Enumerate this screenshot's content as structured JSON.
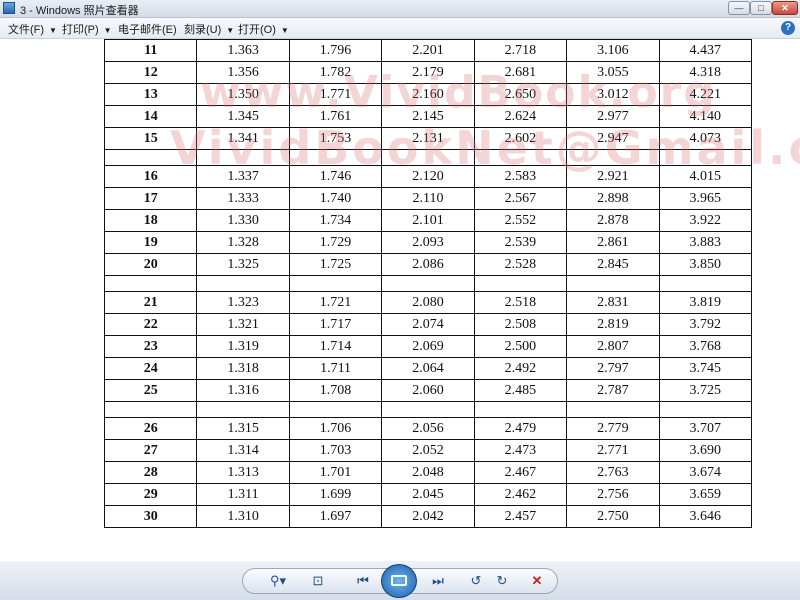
{
  "window": {
    "title": "3 - Windows 照片查看器",
    "controls": {
      "minimize": "—",
      "maximize": "□",
      "close": "✕"
    }
  },
  "menu": {
    "items": [
      {
        "label": "文件(F)"
      },
      {
        "label": "打印(P)"
      },
      {
        "label": "电子邮件(E)"
      },
      {
        "label": "刻录(U)"
      },
      {
        "label": "打开(O)"
      }
    ],
    "help": "?"
  },
  "watermark": {
    "line1": "www.VividBook.org",
    "line2": "VividBookNet@Gmail.com"
  },
  "table": {
    "groups": [
      [
        [
          "11",
          "1.363",
          "1.796",
          "2.201",
          "2.718",
          "3.106",
          "4.437"
        ],
        [
          "12",
          "1.356",
          "1.782",
          "2.179",
          "2.681",
          "3.055",
          "4.318"
        ],
        [
          "13",
          "1.350",
          "1.771",
          "2.160",
          "2.650",
          "3.012",
          "4.221"
        ],
        [
          "14",
          "1.345",
          "1.761",
          "2.145",
          "2.624",
          "2.977",
          "4.140"
        ],
        [
          "15",
          "1.341",
          "1.753",
          "2.131",
          "2.602",
          "2.947",
          "4.073"
        ]
      ],
      [
        [
          "16",
          "1.337",
          "1.746",
          "2.120",
          "2.583",
          "2.921",
          "4.015"
        ],
        [
          "17",
          "1.333",
          "1.740",
          "2.110",
          "2.567",
          "2.898",
          "3.965"
        ],
        [
          "18",
          "1.330",
          "1.734",
          "2.101",
          "2.552",
          "2.878",
          "3.922"
        ],
        [
          "19",
          "1.328",
          "1.729",
          "2.093",
          "2.539",
          "2.861",
          "3.883"
        ],
        [
          "20",
          "1.325",
          "1.725",
          "2.086",
          "2.528",
          "2.845",
          "3.850"
        ]
      ],
      [
        [
          "21",
          "1.323",
          "1.721",
          "2.080",
          "2.518",
          "2.831",
          "3.819"
        ],
        [
          "22",
          "1.321",
          "1.717",
          "2.074",
          "2.508",
          "2.819",
          "3.792"
        ],
        [
          "23",
          "1.319",
          "1.714",
          "2.069",
          "2.500",
          "2.807",
          "3.768"
        ],
        [
          "24",
          "1.318",
          "1.711",
          "2.064",
          "2.492",
          "2.797",
          "3.745"
        ],
        [
          "25",
          "1.316",
          "1.708",
          "2.060",
          "2.485",
          "2.787",
          "3.725"
        ]
      ],
      [
        [
          "26",
          "1.315",
          "1.706",
          "2.056",
          "2.479",
          "2.779",
          "3.707"
        ],
        [
          "27",
          "1.314",
          "1.703",
          "2.052",
          "2.473",
          "2.771",
          "3.690"
        ],
        [
          "28",
          "1.313",
          "1.701",
          "2.048",
          "2.467",
          "2.763",
          "3.674"
        ],
        [
          "29",
          "1.311",
          "1.699",
          "2.045",
          "2.462",
          "2.756",
          "3.659"
        ],
        [
          "30",
          "1.310",
          "1.697",
          "2.042",
          "2.457",
          "2.750",
          "3.646"
        ]
      ]
    ]
  },
  "toolbar": {
    "buttons": [
      {
        "name": "zoom-button",
        "glyph": "⚲▾"
      },
      {
        "name": "actual-size-button",
        "glyph": "⊡"
      },
      {
        "name": "previous-button",
        "glyph": "⏮"
      },
      {
        "name": "next-button",
        "glyph": "⏭"
      },
      {
        "name": "rotate-left-button",
        "glyph": "↺"
      },
      {
        "name": "rotate-right-button",
        "glyph": "↻"
      },
      {
        "name": "delete-button",
        "glyph": "✕"
      }
    ]
  }
}
